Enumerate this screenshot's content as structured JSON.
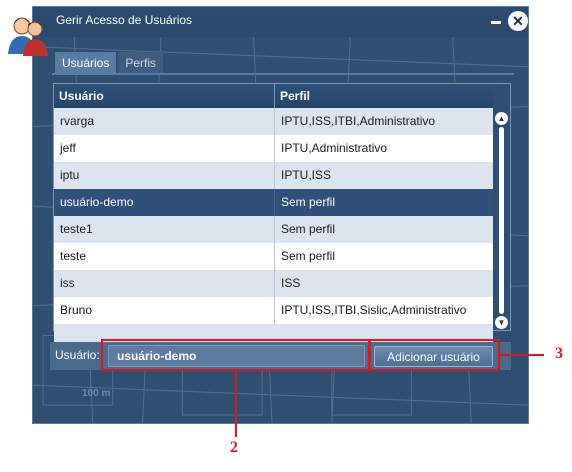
{
  "window": {
    "title": "Gerir Acesso de Usuários",
    "scale_label": "100 m"
  },
  "tabs": [
    {
      "label": "Usuários",
      "active": true
    },
    {
      "label": "Perfis",
      "active": false
    }
  ],
  "table": {
    "columns": [
      "Usuário",
      "Perfil"
    ],
    "rows": [
      {
        "user": "rvarga",
        "profile": "IPTU,ISS,ITBI,Administrativo",
        "selected": false
      },
      {
        "user": "jeff",
        "profile": "IPTU,Administrativo",
        "selected": false
      },
      {
        "user": "iptu",
        "profile": "IPTU,ISS",
        "selected": false
      },
      {
        "user": "usuário-demo",
        "profile": "Sem perfil",
        "selected": true
      },
      {
        "user": "teste1",
        "profile": "Sem perfil",
        "selected": false
      },
      {
        "user": "teste",
        "profile": "Sem perfil",
        "selected": false
      },
      {
        "user": "iss",
        "profile": "ISS",
        "selected": false
      },
      {
        "user": "Bruno",
        "profile": "IPTU,ISS,ITBI,Sislic,Administrativo",
        "selected": false
      }
    ]
  },
  "form": {
    "user_label": "Usuário:",
    "user_value": "usuário-demo",
    "add_button": "Adicionar usuário"
  },
  "annotations": {
    "callout_2": "2",
    "callout_3": "3"
  },
  "icons": {
    "app": "users-icon",
    "close": "close-icon",
    "minimize": "minimize-icon",
    "scroll_up": "scroll-up-icon",
    "scroll_down": "scroll-down-icon"
  },
  "colors": {
    "window_bg": "#2f4f72",
    "header_bg": "#264569",
    "row_alt": "#dde4ee",
    "row_selected": "#2e5079",
    "annotation": "#e0161b"
  }
}
